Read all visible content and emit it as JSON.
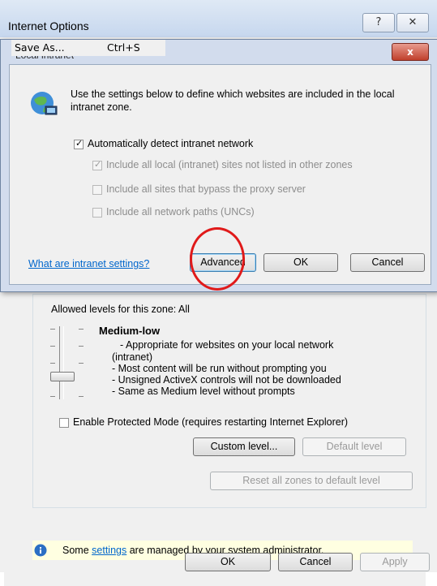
{
  "window": {
    "title": "Internet Options",
    "help_glyph": "?",
    "close_glyph": "✕"
  },
  "context_menu": {
    "item_label": "Save As...",
    "item_shortcut": "Ctrl+S"
  },
  "dialog": {
    "title": "Local intranet",
    "close_glyph": "x",
    "description": "Use the settings below to define which websites are included in the local intranet zone.",
    "icon": "intranet-globe-icon",
    "checkboxes": [
      {
        "label": "Automatically detect intranet network",
        "checked": true,
        "enabled": true
      },
      {
        "label": "Include all local (intranet) sites not listed in other zones",
        "checked": true,
        "enabled": false
      },
      {
        "label": "Include all sites that bypass the proxy server",
        "checked": false,
        "enabled": false
      },
      {
        "label": "Include all network paths (UNCs)",
        "checked": false,
        "enabled": false
      }
    ],
    "help_link": "What are intranet settings?",
    "buttons": {
      "advanced": "Advanced",
      "ok": "OK",
      "cancel": "Cancel"
    }
  },
  "zone": {
    "allowed_levels": "Allowed levels for this zone: All",
    "level_name": "Medium-low",
    "level_desc": [
      "- Appropriate for websites on your local network",
      "(intranet)",
      "- Most content will be run without prompting you",
      "- Unsigned ActiveX controls will not be downloaded",
      "- Same as Medium level without prompts"
    ],
    "protected_mode": {
      "label": "Enable Protected Mode (requires restarting Internet Explorer)",
      "checked": false
    },
    "custom_level": "Custom level...",
    "default_level": "Default level",
    "reset_all": "Reset all zones to default level"
  },
  "info_bar": {
    "prefix": "Some ",
    "link": "settings",
    "suffix": " are managed by your system administrator."
  },
  "footer": {
    "ok": "OK",
    "cancel": "Cancel",
    "apply": "Apply"
  },
  "colors": {
    "annotation_circle": "#e01a1a",
    "link": "#0066cc",
    "info_bar": "#ffffe1"
  }
}
